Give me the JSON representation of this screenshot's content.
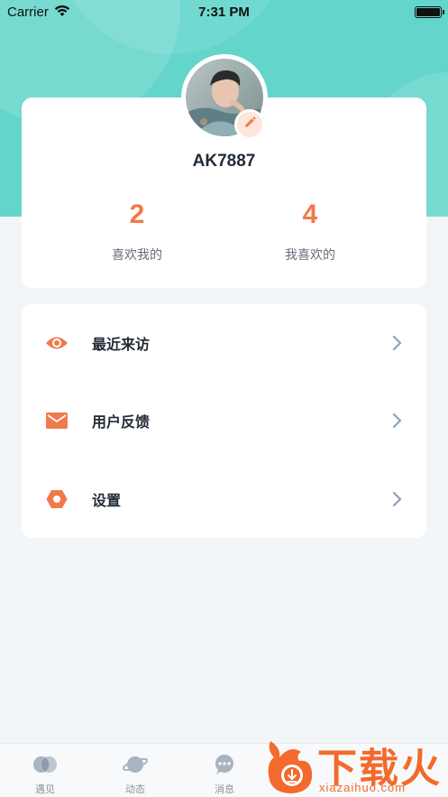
{
  "status_bar": {
    "carrier": "Carrier",
    "time": "7:31 PM"
  },
  "profile": {
    "username": "AK7887",
    "stats": [
      {
        "value": "2",
        "label": "喜欢我的"
      },
      {
        "value": "4",
        "label": "我喜欢的"
      }
    ]
  },
  "menu": {
    "items": [
      {
        "label": "最近来访",
        "icon": "eye-icon"
      },
      {
        "label": "用户反馈",
        "icon": "mail-icon"
      },
      {
        "label": "设置",
        "icon": "settings-hexagon-icon"
      }
    ]
  },
  "tab_bar": {
    "tabs": [
      {
        "label": "遇见",
        "icon": "encounter-icon"
      },
      {
        "label": "动态",
        "icon": "planet-icon"
      },
      {
        "label": "消息",
        "icon": "chat-bubble-icon"
      }
    ]
  },
  "watermark": {
    "title": "下载火",
    "subtitle": "xiazaihuo.com"
  },
  "colors": {
    "header_teal": "#63d5cb",
    "accent_orange": "#f07a4b",
    "chevron": "#8fa1b8"
  }
}
